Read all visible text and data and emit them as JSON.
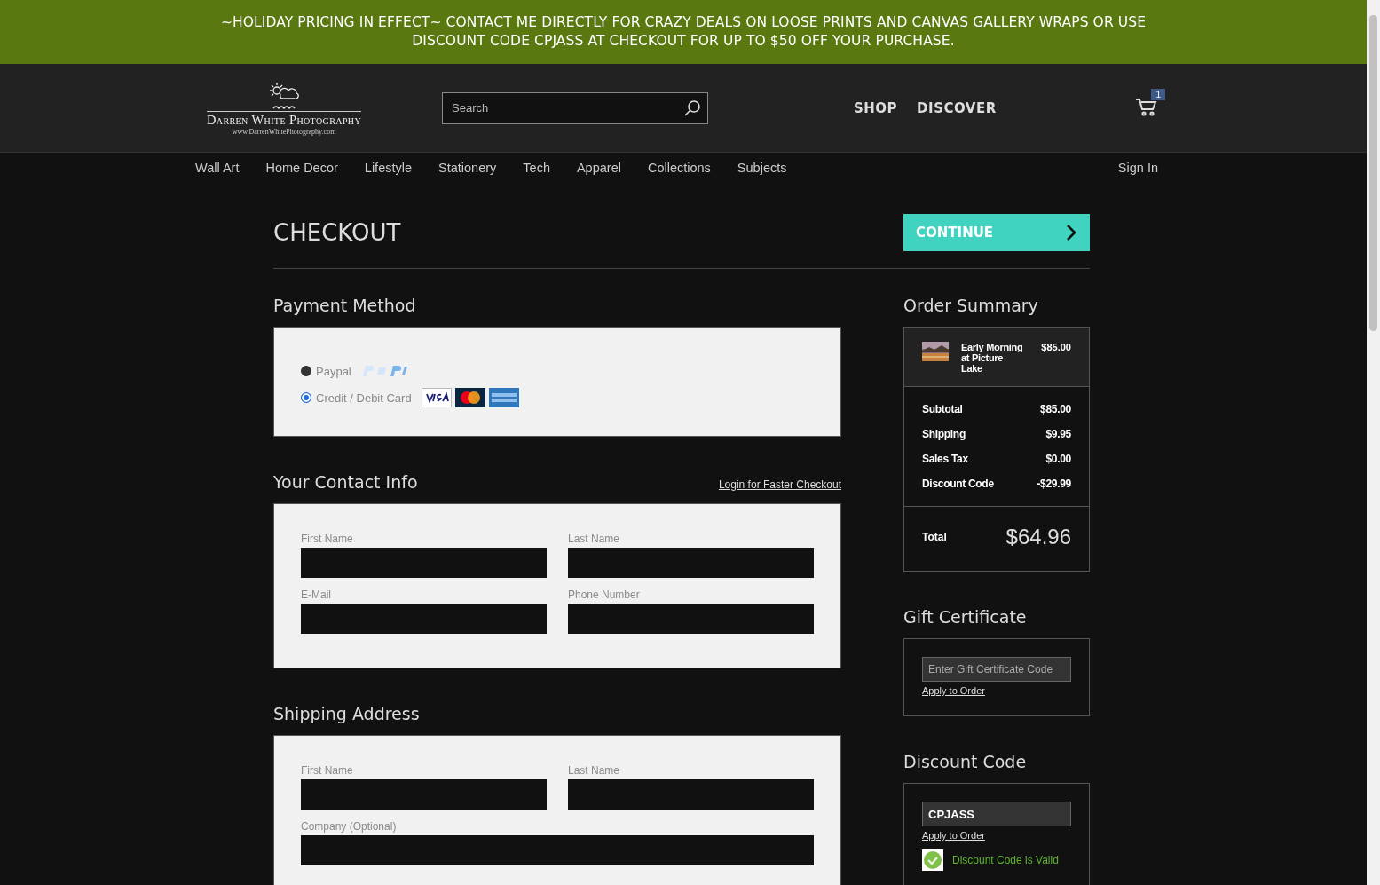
{
  "banner": {
    "lines": [
      "~HOLIDAY PRICING IN EFFECT~ CONTACT ME DIRECTLY FOR CRAZY DEALS ON LOOSE PRINTS AND CANVAS GALLERY WRAPS OR USE",
      "DISCOUNT CODE CPJASS AT CHECKOUT FOR UP TO $50 OFF YOUR PURCHASE."
    ]
  },
  "header": {
    "logo": {
      "name": "Darren White Photography",
      "url": "www.DarrenWhitePhotography.com"
    },
    "search": {
      "placeholder": "Search"
    },
    "nav": [
      "SHOP",
      "DISCOVER"
    ],
    "cart_count": "1"
  },
  "categories": [
    "Wall Art",
    "Home Decor",
    "Lifestyle",
    "Stationery",
    "Tech",
    "Apparel",
    "Collections",
    "Subjects"
  ],
  "sign_in": "Sign In",
  "checkout": {
    "title": "CHECKOUT",
    "continue": "CONTINUE"
  },
  "payment": {
    "heading": "Payment Method",
    "options": [
      {
        "label": "Paypal",
        "kind": "paypal",
        "selected": false
      },
      {
        "label": "Credit / Debit Card",
        "kind": "cards",
        "selected": true
      }
    ]
  },
  "contact": {
    "heading": "Your Contact Info",
    "login_link": "Login for Faster Checkout",
    "fields": [
      {
        "label": "First Name",
        "kind": "half"
      },
      {
        "label": "Last Name",
        "kind": "half"
      },
      {
        "label": "E-Mail",
        "kind": "half"
      },
      {
        "label": "Phone Number",
        "kind": "half"
      }
    ]
  },
  "shipping": {
    "heading": "Shipping Address",
    "fields": [
      {
        "label": "First Name",
        "kind": "half"
      },
      {
        "label": "Last Name",
        "kind": "half"
      },
      {
        "label": "Company (Optional)",
        "kind": "full"
      }
    ]
  },
  "order_summary": {
    "heading": "Order Summary",
    "item": {
      "name": "Early Morning at Picture Lake",
      "price": "$85.00"
    },
    "rows": [
      {
        "label": "Subtotal",
        "value": "$85.00"
      },
      {
        "label": "Shipping",
        "value": "$9.95"
      },
      {
        "label": "Sales Tax",
        "value": "$0.00"
      },
      {
        "label": "Discount Code",
        "value": "-$29.99"
      }
    ],
    "total_label": "Total",
    "total": "$64.96"
  },
  "gift_certificate": {
    "heading": "Gift Certificate",
    "placeholder": "Enter Gift Certificate Code",
    "apply": "Apply to Order"
  },
  "discount_code": {
    "heading": "Discount Code",
    "value": "CPJASS",
    "apply": "Apply to Order",
    "message": "Discount Code is Valid"
  }
}
